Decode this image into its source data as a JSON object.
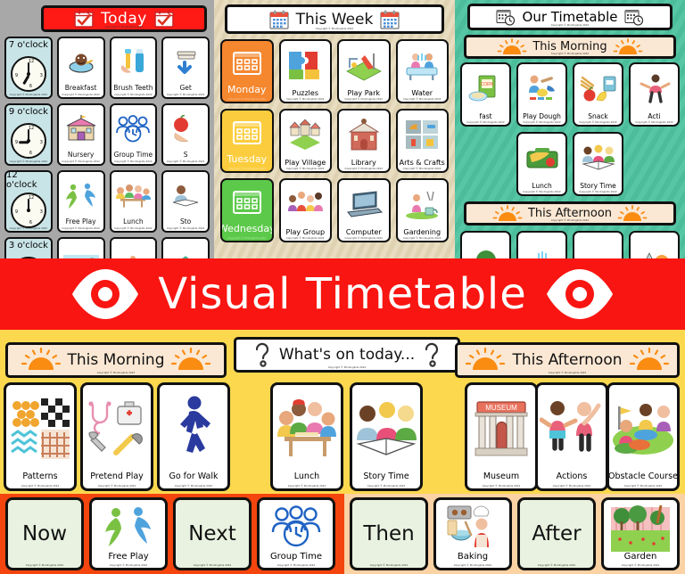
{
  "banner": {
    "title": "Visual Timetable",
    "bg_color": "#f91511",
    "text_color": "#ffffff",
    "left_icon": "eye-icon",
    "right_icon": "eye-icon"
  },
  "today_panel": {
    "header": {
      "title": "Today",
      "left_icon": "calendar-check-icon",
      "right_icon": "calendar-check-icon",
      "bg_color": "#ff1a16"
    },
    "copyright": "Copyright © Mindingkids 2022",
    "rows": [
      {
        "time": "7 o'clock",
        "hour": 7,
        "cards": [
          "Breakfast",
          "Brush Teeth",
          "Get"
        ]
      },
      {
        "time": "9 o'clock",
        "hour": 9,
        "cards": [
          "Nursery",
          "Group Time",
          "S"
        ]
      },
      {
        "time": "12 o'clock",
        "hour": 12,
        "cards": [
          "Free Play",
          "Lunch",
          "Sto"
        ]
      },
      {
        "time": "3 o'clock",
        "hour": 3,
        "cards": [
          "",
          "",
          ""
        ]
      }
    ]
  },
  "week_panel": {
    "header": {
      "title": "This Week",
      "left_icon": "calendar-icon",
      "right_icon": "calendar-icon",
      "bg_color": "#ffffff"
    },
    "days": [
      {
        "label": "Monday",
        "color": "#f5872e",
        "activities": [
          "Puzzles",
          "Play Park",
          "Water"
        ]
      },
      {
        "label": "Tuesday",
        "color": "#fbcd3e",
        "activities": [
          "Play Village",
          "Library",
          "Arts & Crafts"
        ]
      },
      {
        "label": "Wednesday",
        "color": "#5cc94a",
        "activities": [
          "Play Group",
          "Computer",
          "Gardening"
        ]
      }
    ]
  },
  "timetable_panel": {
    "header": {
      "title": "Our Timetable",
      "left_icon": "calendar-clock-icon",
      "right_icon": "calendar-clock-icon",
      "bg_color": "#ffffff"
    },
    "bg_color": "#4cbd9b",
    "morning_header": {
      "title": "This Morning",
      "left_icon": "sun-icon",
      "right_icon": "sun-icon",
      "bg_color": "#fbe8d4"
    },
    "morning_cards_row1": [
      "fast",
      "Play Dough",
      "Snack",
      "Acti"
    ],
    "morning_cards_row2": [
      "",
      "Lunch",
      "Story Time",
      ""
    ],
    "afternoon_header": {
      "title": "This Afternoon",
      "left_icon": "sun-icon",
      "right_icon": "sun-icon",
      "bg_color": "#fbe8d4"
    }
  },
  "yellow_section": {
    "bg_color": "#fcd84f",
    "morning_header": {
      "title": "This Morning",
      "left_icon": "sun-icon",
      "right_icon": "sun-icon",
      "bg_color": "#fbe8d4"
    },
    "what_header": {
      "title": "What's on today...",
      "left_icon": "question-mark-icon",
      "right_icon": "question-mark-icon",
      "bg_color": "#ffffff"
    },
    "afternoon_header": {
      "title": "This Afternoon",
      "left_icon": "sun-icon",
      "right_icon": "sun-icon",
      "bg_color": "#fbe8d4"
    },
    "morning_cards": [
      "Patterns",
      "Pretend Play",
      "Go for Walk"
    ],
    "middle_cards": [
      "Lunch",
      "Story Time"
    ],
    "afternoon_cards": [
      "Museum",
      "Actions",
      "Obstacle Course"
    ]
  },
  "bottom_row": {
    "red_strip_color": "#f4450e",
    "peach_strip_color": "#fbd2a4",
    "items": [
      {
        "type": "word",
        "label": "Now"
      },
      {
        "type": "activity",
        "label": "Free Play"
      },
      {
        "type": "word",
        "label": "Next"
      },
      {
        "type": "activity",
        "label": "Group Time"
      },
      {
        "type": "word",
        "label": "Then"
      },
      {
        "type": "activity",
        "label": "Baking"
      },
      {
        "type": "word",
        "label": "After"
      },
      {
        "type": "activity",
        "label": "Garden"
      }
    ]
  }
}
